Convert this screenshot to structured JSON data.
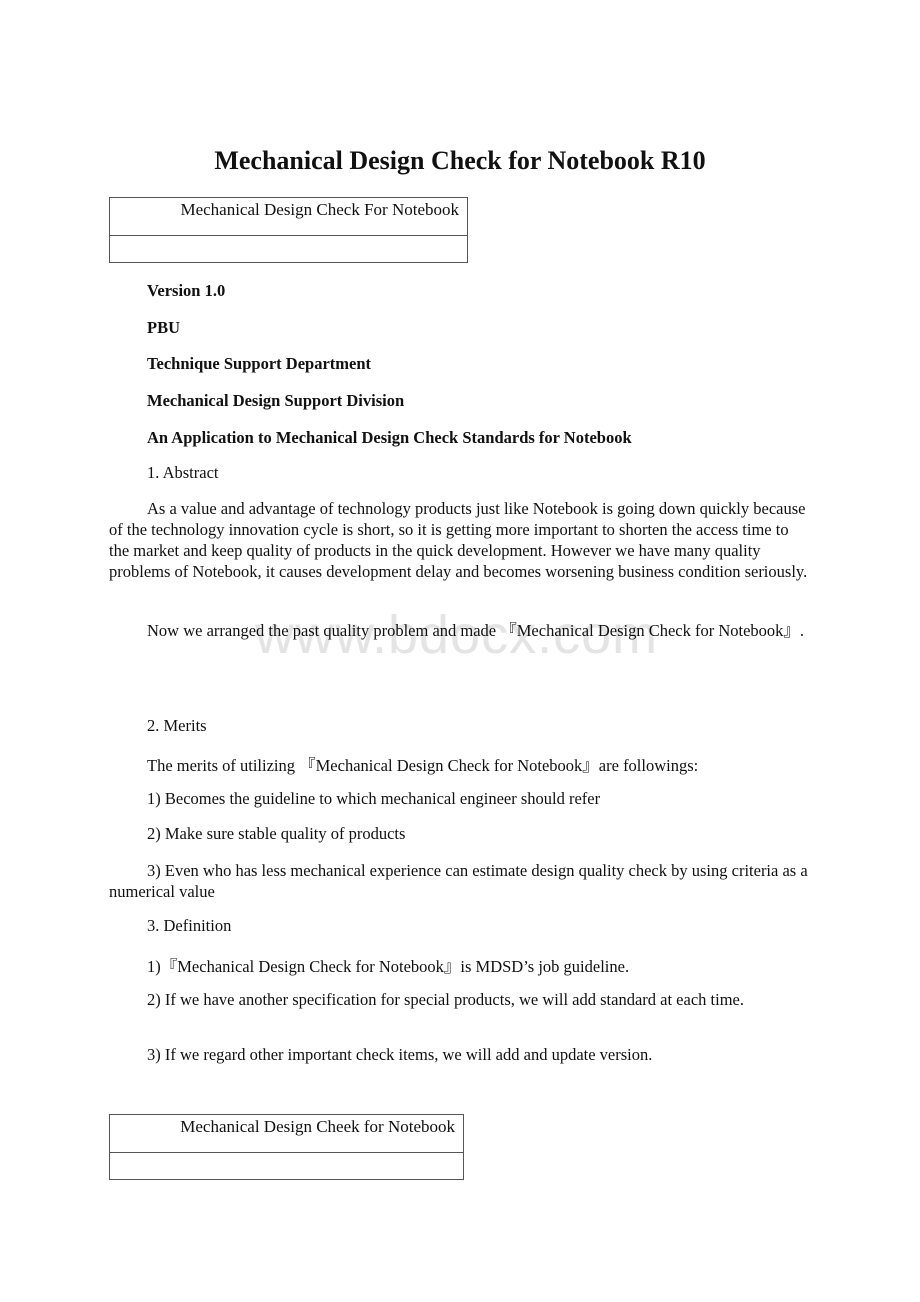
{
  "document": {
    "title": "Mechanical Design Check for Notebook R10",
    "header_table_1": {
      "cell_text": "Mechanical Design Check For Notebook",
      "row2_text": ""
    },
    "meta": {
      "version": "Version 1.0",
      "unit": "PBU",
      "department": "Technique Support Department",
      "division": "Mechanical Design Support Division",
      "subtitle": "An Application to Mechanical Design Check Standards for Notebook"
    },
    "sections": {
      "abstract": {
        "heading": "1. Abstract",
        "paragraphs": [
          "As a value and advantage of technology products just like Notebook is going down quickly because of the technology innovation cycle is short, so it is getting more important to shorten the access time to the market and keep quality of products in the quick development. However we have many quality problems of Notebook, it causes development delay and becomes worsening business condition seriously.",
          "Now we arranged the past quality problem and made 『Mechanical Design Check for Notebook』."
        ]
      },
      "merits": {
        "heading": "2. Merits",
        "intro": "The merits of utilizing 『Mechanical Design Check for Notebook』are followings:",
        "items": [
          "1) Becomes the guideline to which mechanical engineer should refer",
          "2) Make sure stable quality of products",
          "3) Even who has less mechanical experience can estimate design quality check by using criteria as a numerical value"
        ]
      },
      "definition": {
        "heading": "3. Definition",
        "items": [
          "1)『Mechanical Design Check for Notebook』is MDSD’s job guideline.",
          "2) If we have another specification for special products, we will add standard at each time.",
          "3) If we regard other important check items, we will add and update version."
        ]
      }
    },
    "header_table_2": {
      "cell_text": "Mechanical Design Cheek for Notebook",
      "row2_text": ""
    },
    "watermark": "www.bdocx.com"
  }
}
